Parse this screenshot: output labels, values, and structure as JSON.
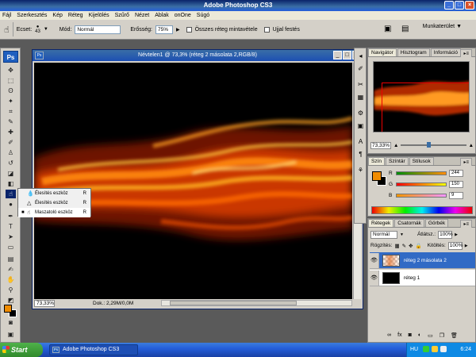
{
  "app": {
    "title": "Adobe Photoshop CS3"
  },
  "menu": [
    "Fájl",
    "Szerkesztés",
    "Kép",
    "Réteg",
    "Kijelölés",
    "Szűrő",
    "Nézet",
    "Ablak",
    "onOne",
    "Súgó"
  ],
  "options": {
    "brush_label": "Ecset:",
    "brush_size": "43",
    "mode_label": "Mód:",
    "mode_value": "Normál",
    "strength_label": "Erősség:",
    "strength_value": "75%",
    "sample_all_label": "Összes réteg mintavétele",
    "finger_paint_label": "Ujjal festés",
    "workspace_label": "Munkaterület"
  },
  "flyout": {
    "items": [
      {
        "label": "Élesítés eszköz",
        "key": "R"
      },
      {
        "label": "Élesítés eszköz",
        "key": "R"
      },
      {
        "label": "Maszatoló eszköz",
        "key": "R"
      }
    ]
  },
  "document": {
    "title": "Névtelen1 @ 73,3% (réteg 2 másolata 2,RGB/8)",
    "zoom": "73,33%",
    "doc_size": "Dok.: 2,29M/0,0M"
  },
  "navigator": {
    "tabs": [
      "Navigátor",
      "Hisztogram",
      "Információ"
    ],
    "zoom": "73,33%"
  },
  "color": {
    "tabs": [
      "Szín",
      "Színtár",
      "Stílusok"
    ],
    "r_label": "R",
    "r_value": "244",
    "g_label": "G",
    "g_value": "150",
    "b_label": "B",
    "b_value": "9",
    "fg": "#f08c00",
    "bg": "#000000"
  },
  "layers": {
    "tabs": [
      "Rétegek",
      "Csatornák",
      "Görbék"
    ],
    "blend_mode": "Normál",
    "opacity_label": "Átlátsz.:",
    "opacity_value": "100%",
    "lock_label": "Rögzítés:",
    "fill_label": "Kitöltés:",
    "fill_value": "100%",
    "items": [
      {
        "name": "réteg 2 másolata 2",
        "selected": true
      },
      {
        "name": "réteg 1",
        "selected": false
      }
    ]
  },
  "taskbar": {
    "start_label": "Start",
    "task_label": "Adobe Photoshop CS3",
    "tray_lang": "HU",
    "clock": "6:24"
  }
}
